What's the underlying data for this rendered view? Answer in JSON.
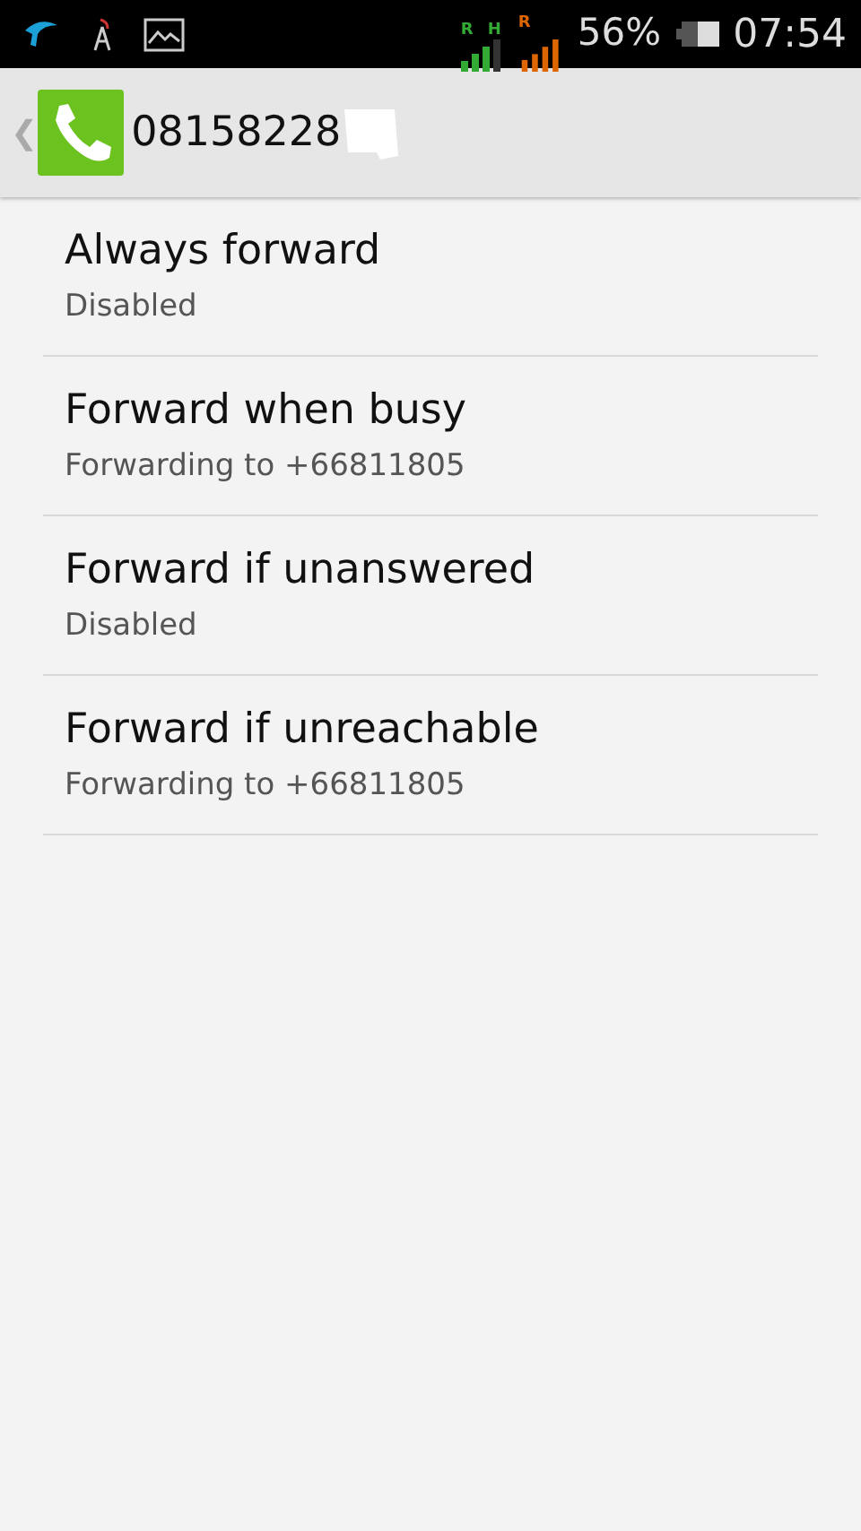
{
  "status_bar": {
    "signal_1_labels": [
      "R",
      "H"
    ],
    "signal_2_label": "R",
    "battery_percent": "56%",
    "time": "07:54"
  },
  "action_bar": {
    "back": "❮",
    "title": "08158228"
  },
  "items": [
    {
      "title": "Always forward",
      "summary": "Disabled"
    },
    {
      "title": "Forward when busy",
      "summary": "Forwarding to +66811805"
    },
    {
      "title": "Forward if unanswered",
      "summary": "Disabled"
    },
    {
      "title": "Forward if unreachable",
      "summary": "Forwarding to +66811805"
    }
  ]
}
